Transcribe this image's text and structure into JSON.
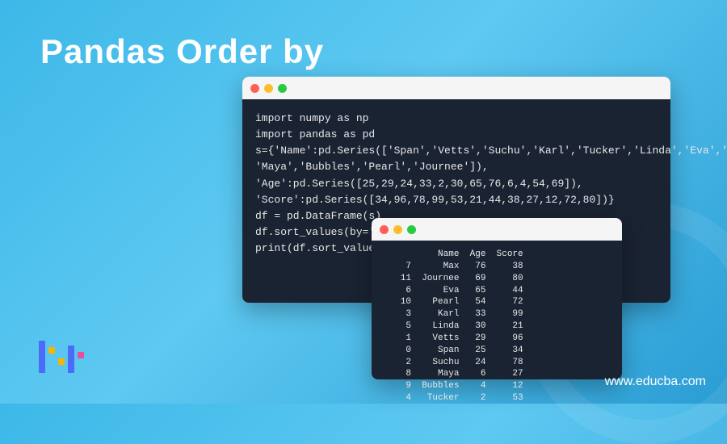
{
  "title": "Pandas Order by",
  "code": {
    "lines": [
      "import numpy as np",
      "import pandas as pd",
      "s={'Name':pd.Series(['Span','Vetts','Suchu','Karl','Tucker','Linda','Eva','Max',",
      "'Maya','Bubbles','Pearl','Journee']),",
      "'Age':pd.Series([25,29,24,33,2,30,65,76,6,4,54,69]),",
      "'Score':pd.Series([34,96,78,99,53,21,44,38,27,12,72,80])}",
      "df = pd.DataFrame(s)",
      "df.sort_values(by='Age',a",
      "print(df.sort_values(by="
    ]
  },
  "chart_data": {
    "type": "table",
    "columns": [
      "",
      "Name",
      "Age",
      "Score"
    ],
    "rows": [
      [
        "7",
        "Max",
        "76",
        "38"
      ],
      [
        "11",
        "Journee",
        "69",
        "80"
      ],
      [
        "6",
        "Eva",
        "65",
        "44"
      ],
      [
        "10",
        "Pearl",
        "54",
        "72"
      ],
      [
        "3",
        "Karl",
        "33",
        "99"
      ],
      [
        "5",
        "Linda",
        "30",
        "21"
      ],
      [
        "1",
        "Vetts",
        "29",
        "96"
      ],
      [
        "0",
        "Span",
        "25",
        "34"
      ],
      [
        "2",
        "Suchu",
        "24",
        "78"
      ],
      [
        "8",
        "Maya",
        "6",
        "27"
      ],
      [
        "9",
        "Bubbles",
        "4",
        "12"
      ],
      [
        "4",
        "Tucker",
        "2",
        "53"
      ]
    ]
  },
  "footer": {
    "url": "www.educba.com"
  }
}
